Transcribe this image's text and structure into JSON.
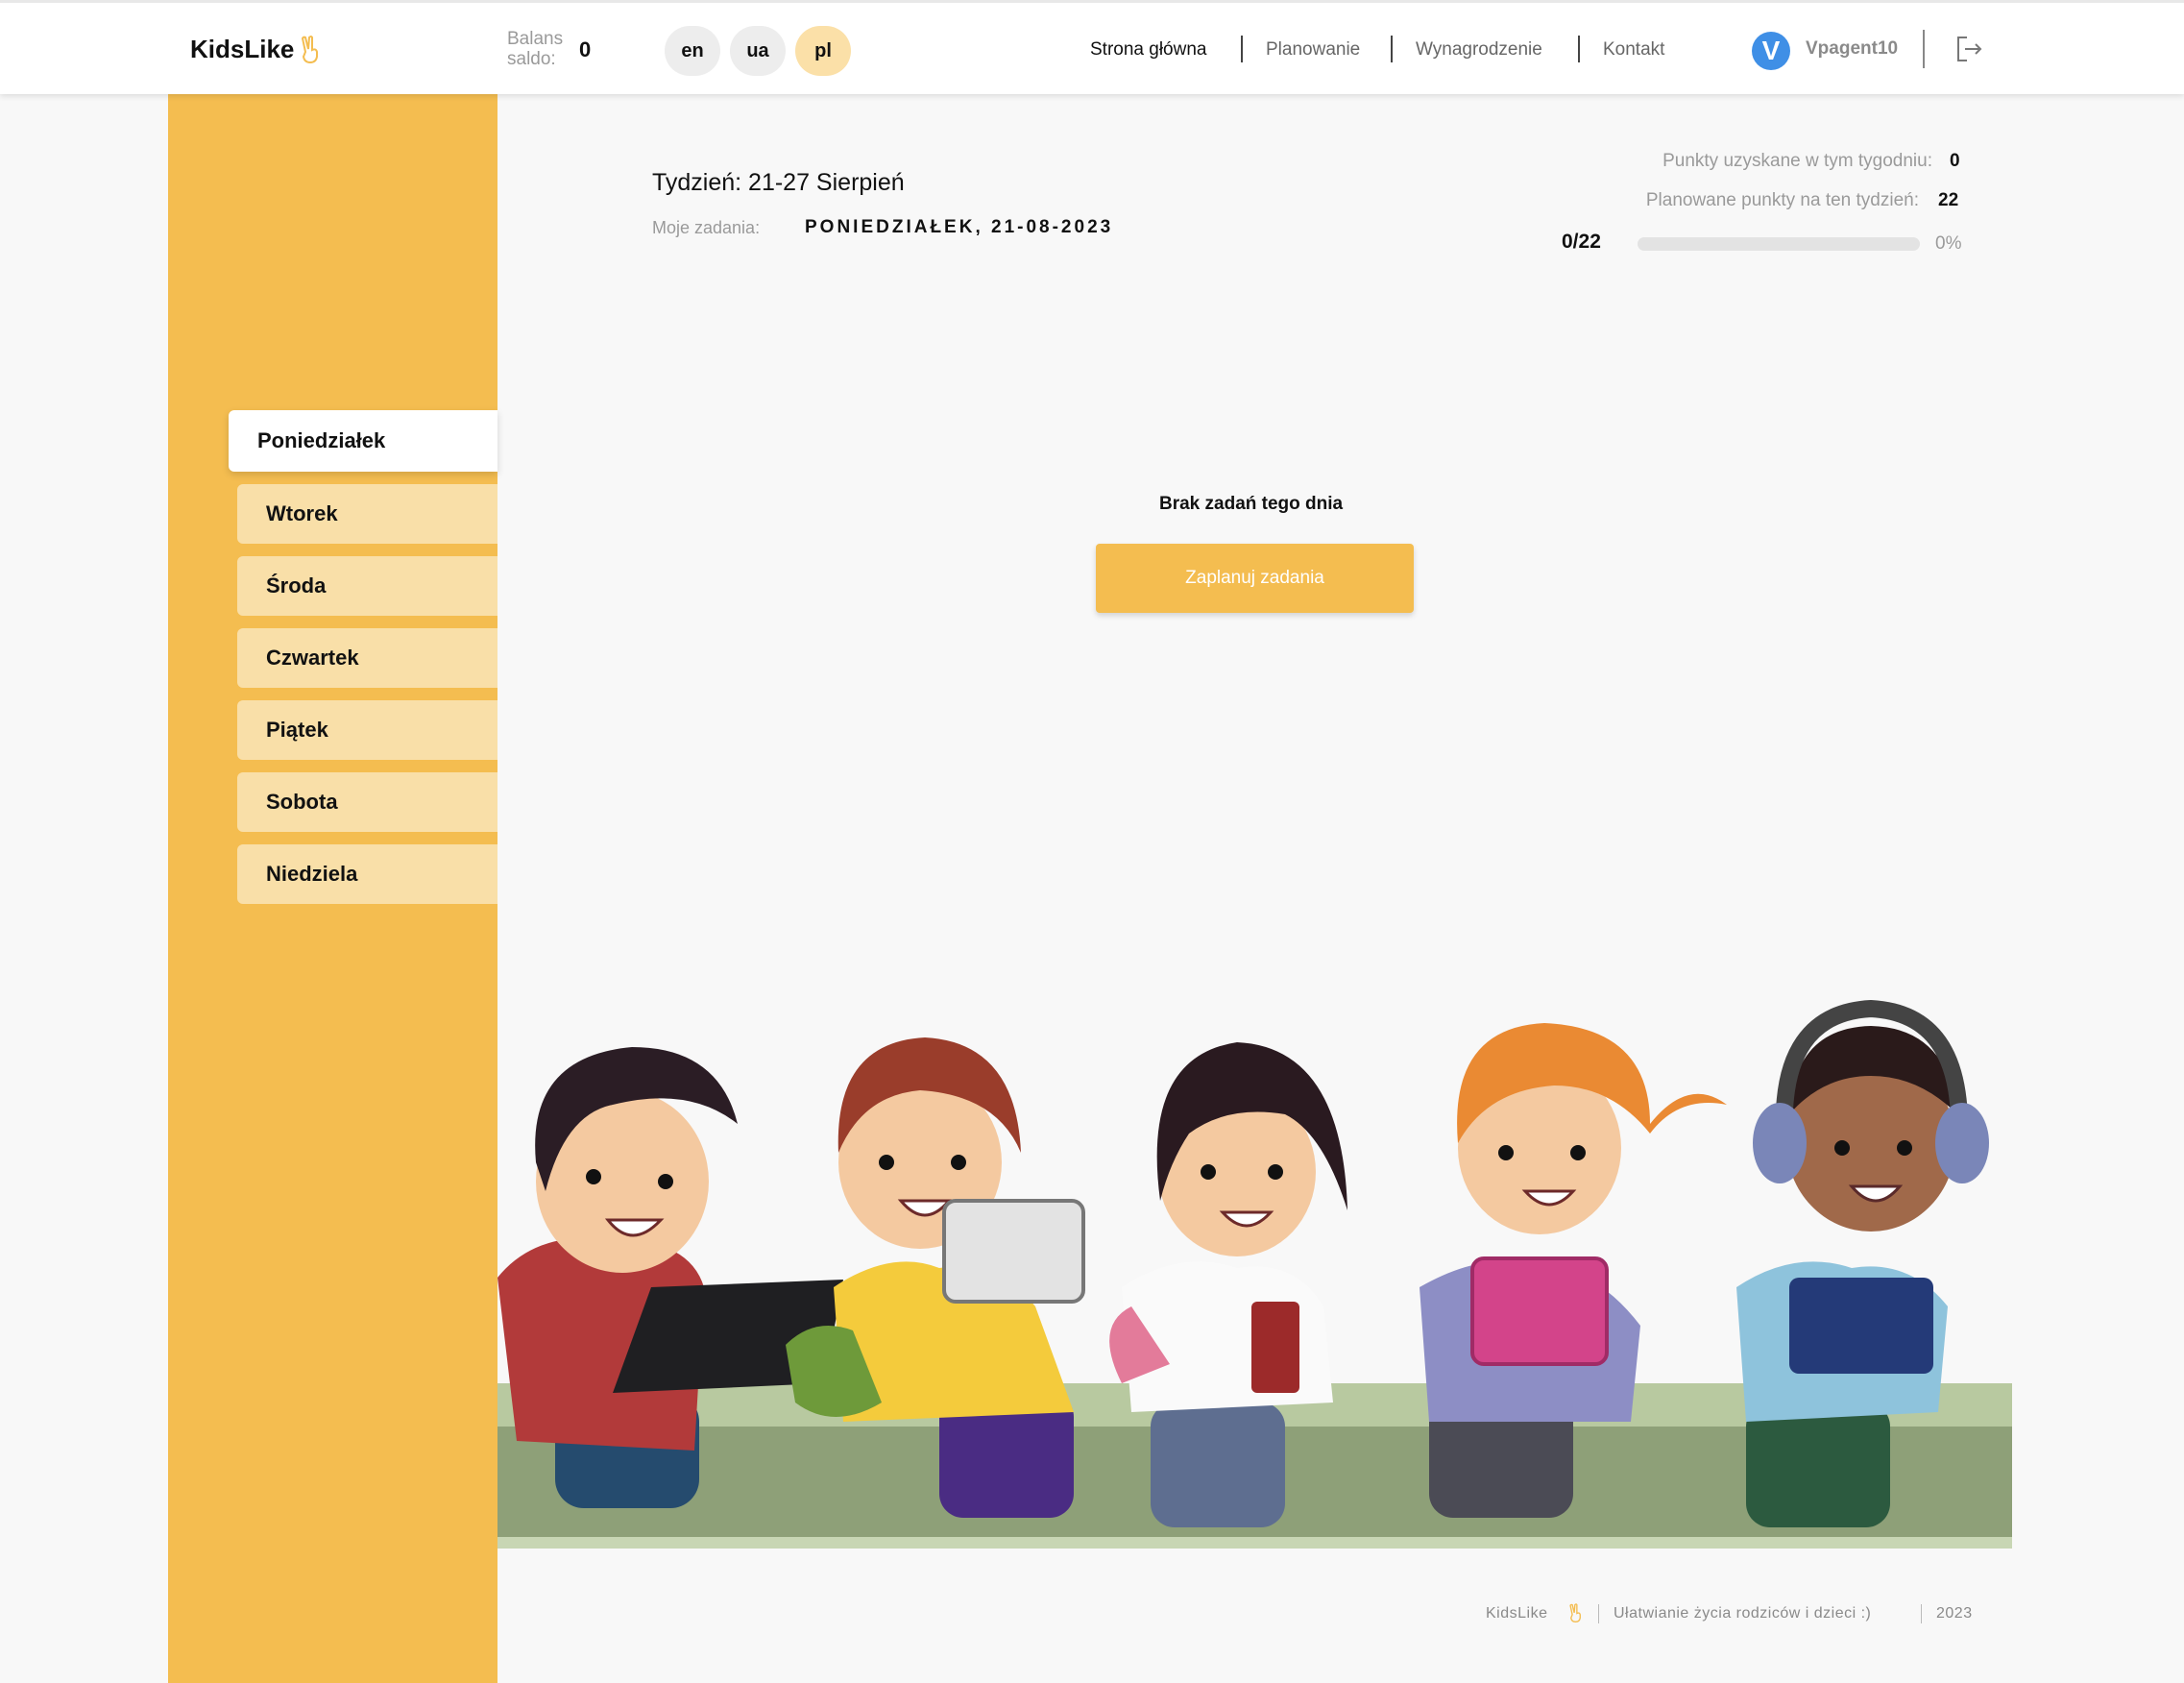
{
  "header": {
    "logo": "KidsLike",
    "balance_label": "Balans saldo:",
    "balance_value": "0",
    "languages": [
      "en",
      "ua",
      "pl"
    ],
    "active_language": "pl",
    "nav": [
      "Strona główna",
      "Planowanie",
      "Wynagrodzenie",
      "Kontakt"
    ],
    "active_nav": "Strona główna",
    "user_initial": "V",
    "username": "Vpagent10"
  },
  "sidebar": {
    "days": [
      "Poniedziałek",
      "Wtorek",
      "Środa",
      "Czwartek",
      "Piątek",
      "Sobota",
      "Niedziela"
    ],
    "active_day": "Poniedziałek"
  },
  "main": {
    "week_title": "Tydzień: 21-27 Sierpień",
    "tasks_label": "Moje zadania:",
    "tasks_date": "PONIEDZIAŁEK, 21-08-2023",
    "points_earned_label": "Punkty uzyskane w tym tygodniu:",
    "points_earned_value": "0",
    "points_planned_label": "Planowane punkty na ten tydzień:",
    "points_planned_value": "22",
    "progress_count": "0/22",
    "progress_fraction": 0,
    "progress_percent": "0%",
    "empty_message": "Brak zadań tego dnia",
    "plan_button": "Zaplanuj zadania"
  },
  "footer": {
    "brand": "KidsLike",
    "tagline": "Ułatwianie życia rodziców i dzieci :)",
    "year": "2023"
  },
  "colors": {
    "accent": "#f4bd50",
    "accent_light": "#f9dfa8",
    "avatar": "#3f8fe6"
  }
}
